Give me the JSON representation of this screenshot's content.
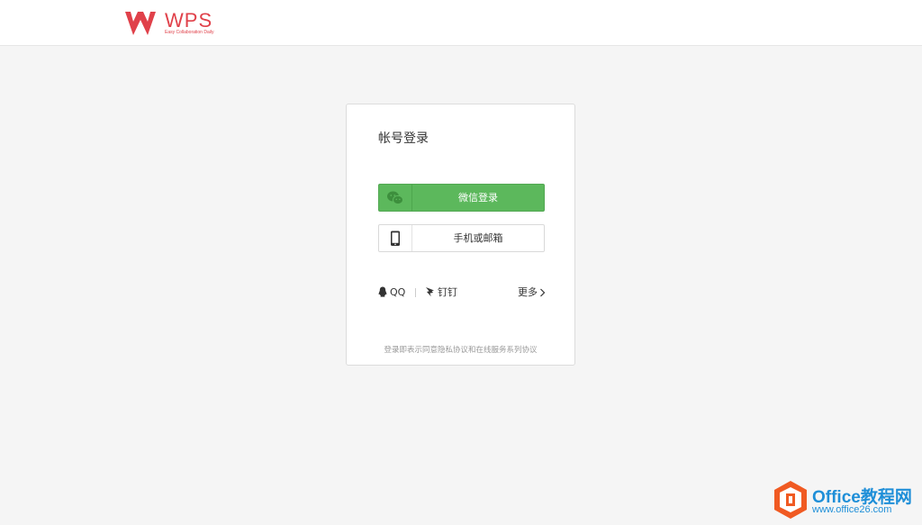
{
  "header": {
    "logo_word": "WPS",
    "logo_tagline": "Easy Collaboration Daily"
  },
  "login": {
    "title": "帐号登录",
    "wechat_label": "微信登录",
    "phone_label": "手机或邮箱",
    "alternatives": {
      "qq": "QQ",
      "dingtalk": "钉钉",
      "more": "更多"
    },
    "agreement": "登录即表示同意隐私协议和在线服务系列协议"
  },
  "watermark": {
    "title": "Office教程网",
    "url": "www.office26.com"
  },
  "colors": {
    "brand_red": "#e0414a",
    "wechat_green": "#5cb85c",
    "watermark_blue": "#1f8fd8",
    "watermark_orange": "#f05a22"
  }
}
